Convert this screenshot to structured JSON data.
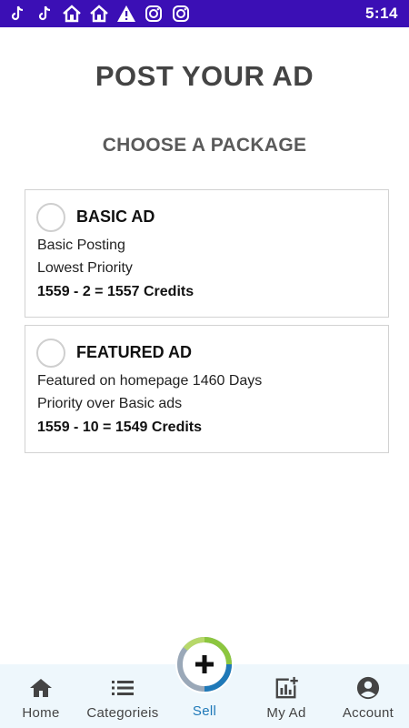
{
  "status_bar": {
    "time": "5:14",
    "icons": [
      "tiktok-icon",
      "tiktok-icon",
      "home-icon",
      "home-icon",
      "warning-icon",
      "instagram-icon",
      "instagram-icon"
    ],
    "background": "#3b0fb5"
  },
  "header": {
    "title": "POST YOUR AD",
    "subtitle": "CHOOSE A PACKAGE"
  },
  "packages": [
    {
      "name": "BASIC AD",
      "lines": [
        "Basic Posting",
        "Lowest Priority"
      ],
      "credits": "1559 - 2 = 1557 Credits",
      "selected": false
    },
    {
      "name": "FEATURED AD",
      "lines": [
        "Featured on homepage 1460 Days",
        "Priority over Basic ads"
      ],
      "credits": "1559 - 10 = 1549 Credits",
      "selected": false
    }
  ],
  "bottom_nav": {
    "items": [
      {
        "label": "Home",
        "icon": "home-icon"
      },
      {
        "label": "Categorieis",
        "icon": "list-icon"
      },
      {
        "label": "Sell",
        "icon": "plus-icon",
        "active": true
      },
      {
        "label": "My Ad",
        "icon": "chart-add-icon"
      },
      {
        "label": "Account",
        "icon": "account-circle-icon"
      }
    ],
    "accent": "#1f79b8"
  }
}
